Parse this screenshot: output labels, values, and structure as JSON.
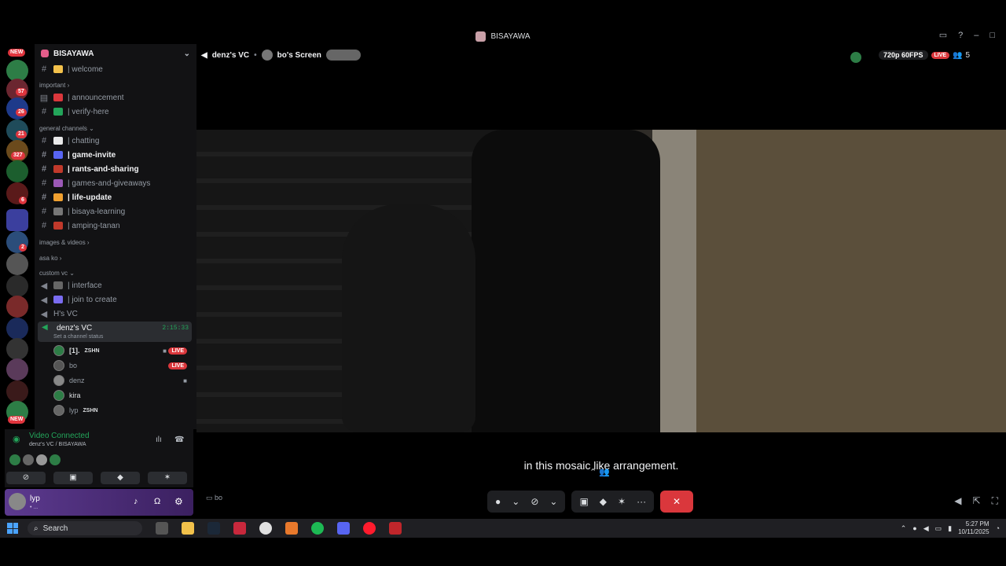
{
  "window": {
    "title": "BISAYAWA"
  },
  "rail": {
    "badges": [
      "NEW",
      "57",
      "26",
      "21",
      "327",
      "6",
      "2",
      "NEW"
    ]
  },
  "sidebar": {
    "server_name": "BISAYAWA",
    "channels_top": [
      {
        "name": "| welcome"
      }
    ],
    "category_important": "important",
    "important": [
      {
        "name": "| announcement"
      },
      {
        "name": "| verify-here"
      }
    ],
    "category_general": "general channels",
    "general": [
      {
        "name": "| chatting"
      },
      {
        "name": "| game-invite"
      },
      {
        "name": "| rants-and-sharing"
      },
      {
        "name": "| games-and-giveaways"
      },
      {
        "name": "| life-update"
      },
      {
        "name": "| bisaya-learning"
      },
      {
        "name": "| amping-tanan"
      }
    ],
    "category_images": "images & videos",
    "category_asako": "asa ko",
    "category_custom": "custom vc",
    "custom": [
      {
        "name": "| interface"
      },
      {
        "name": "| join to create"
      },
      {
        "name": "H's VC"
      }
    ],
    "active_vc": {
      "name": "denz's VC",
      "status": "Set a channel status",
      "time": "2:15:33"
    },
    "members": [
      {
        "name": "[1].",
        "tag": "ZSHN",
        "live": "LIVE"
      },
      {
        "name": "bo",
        "tag": "",
        "live": "LIVE"
      },
      {
        "name": "denz",
        "tag": "",
        "live": ""
      },
      {
        "name": "kira",
        "tag": "",
        "live": ""
      },
      {
        "name": "lyp",
        "tag": "ZSHN",
        "live": ""
      }
    ]
  },
  "voice": {
    "connected": "Video Connected",
    "path": "denz's VC / BISAYAWA"
  },
  "user": {
    "name": "lyp",
    "status": "• ..."
  },
  "stage": {
    "channel": "denz's VC",
    "screen": "bo's Screen",
    "resolution": "720p 60FPS",
    "live_badge": "LIVE",
    "viewer_count": "5",
    "subtitle": "in this mosaic like arrangement.",
    "speaker_label": "bo"
  },
  "taskbar": {
    "search_placeholder": "Search",
    "time": "5:27 PM",
    "date": "10/11/2025"
  },
  "colors": {
    "accent_green": "#23a55a",
    "live_red": "#da373c",
    "user_purple": "#5c3a8f"
  }
}
